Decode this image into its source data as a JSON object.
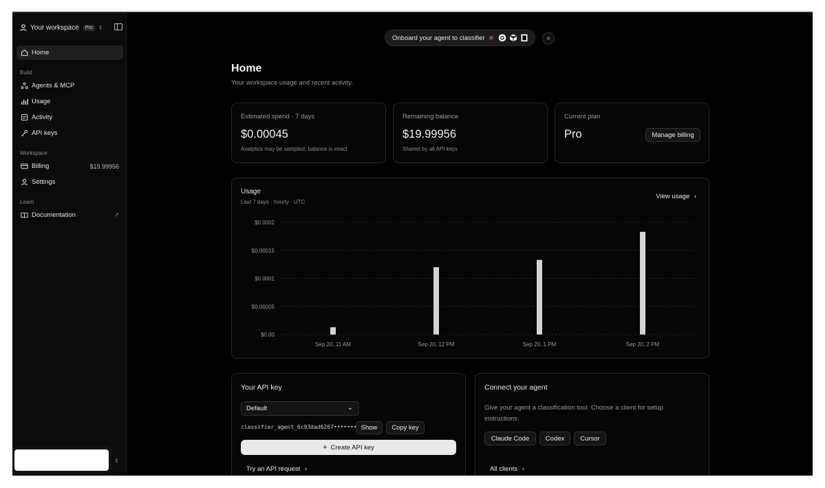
{
  "sidebar": {
    "workspace_name": "Your workspace",
    "plan_badge": "Pro",
    "items": [
      {
        "label": "Home",
        "icon": "home-icon"
      },
      {
        "label": "Agents & MCP",
        "icon": "agents-icon"
      },
      {
        "label": "Usage",
        "icon": "usage-icon"
      },
      {
        "label": "Activity",
        "icon": "activity-icon"
      },
      {
        "label": "API keys",
        "icon": "key-icon"
      },
      {
        "label": "Billing",
        "icon": "card-icon",
        "value": "$19.99956"
      },
      {
        "label": "Settings",
        "icon": "person-icon"
      },
      {
        "label": "Documentation",
        "icon": "book-icon"
      }
    ],
    "sections": [
      "Build",
      "Workspace",
      "Learn"
    ]
  },
  "banner": {
    "text": "Onboard your agent to classifier",
    "icons": [
      "claude-icon",
      "openai-icon",
      "cube-icon",
      "cursor-icon"
    ]
  },
  "page": {
    "title": "Home",
    "subtitle": "Your workspace usage and recent activity."
  },
  "stats": {
    "spend_label": "Estimated spend · 7 days",
    "spend_value": "$0.00045",
    "spend_note": "Analytics may be sampled; balance is exact",
    "balance_label": "Remaining balance",
    "balance_value": "$19.99956",
    "balance_note": "Shared by all API keys",
    "plan_label": "Current plan",
    "plan_value": "Pro",
    "manage_billing": "Manage billing"
  },
  "usage": {
    "title": "Usage",
    "subtitle": "Last 7 days · hourly · UTC",
    "view_link": "View usage"
  },
  "chart_data": {
    "type": "bar",
    "title": "",
    "xlabel": "",
    "ylabel": "",
    "x_ticks": [
      "Sep 20, 11 AM",
      "Sep 20, 12 PM",
      "Sep 20, 1 PM",
      "Sep 20, 2 PM"
    ],
    "y_ticks": [
      "$0.0002",
      "$0.00015",
      "$0.0001",
      "$0.00005",
      "$0.00"
    ],
    "ylim": [
      0,
      0.0002
    ],
    "categories": [
      "Sep 20, 11 AM",
      "Sep 20, 12 PM",
      "Sep 20, 1 PM",
      "Sep 20, 2 PM"
    ],
    "values": [
      1.3e-05,
      0.00012,
      0.000133,
      0.000183
    ],
    "grid": true,
    "bar_color": "#d4d4d4"
  },
  "api_key": {
    "title": "Your API key",
    "selected": "Default",
    "key_masked": "classifier_agent_6c93dad6267••••••••",
    "show": "Show",
    "copy": "Copy key",
    "create": "Create API key",
    "try_link": "Try an API request"
  },
  "connect": {
    "title": "Connect your agent",
    "description": "Give your agent a classification tool. Choose a client for setup instructions.",
    "clients": [
      "Claude Code",
      "Codex",
      "Cursor"
    ],
    "all_clients": "All clients"
  }
}
